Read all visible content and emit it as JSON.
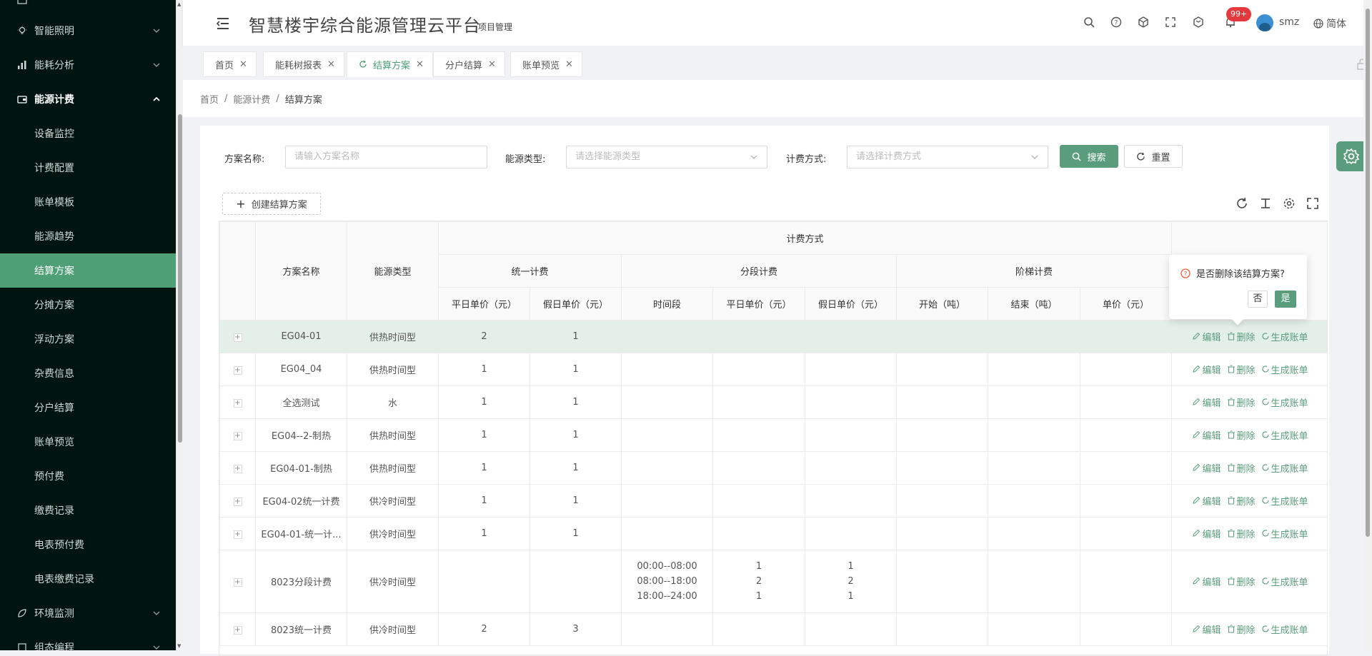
{
  "app": {
    "title": "智慧楼宇综合能源管理云平台",
    "subtitle": "项目管理",
    "notifications": "99+",
    "username": "smz",
    "language": "简体"
  },
  "sidebar": {
    "top_items": [
      {
        "label": "智能照明",
        "icon": "bulb-icon"
      },
      {
        "label": "能耗分析",
        "icon": "bar-chart-icon"
      },
      {
        "label": "能源计费",
        "icon": "wallet-icon"
      }
    ],
    "sub_items": [
      "设备监控",
      "计费配置",
      "账单模板",
      "能源趋势",
      "结算方案",
      "分摊方案",
      "浮动方案",
      "杂费信息",
      "分户结算",
      "账单预览",
      "预付费",
      "缴费记录",
      "电表预付费",
      "电表缴费记录"
    ],
    "bottom_items": [
      {
        "label": "环境监测",
        "icon": "leaf-icon"
      },
      {
        "label": "组态编程",
        "icon": "puzzle-icon"
      }
    ]
  },
  "tabs": [
    "首页",
    "能耗树报表",
    "结算方案",
    "分户结算",
    "账单预览"
  ],
  "breadcrumb": [
    "首页",
    "能源计费",
    "结算方案"
  ],
  "search": {
    "name_label": "方案名称:",
    "name_placeholder": "请输入方案名称",
    "type_label": "能源类型:",
    "type_placeholder": "请选择能源类型",
    "method_label": "计费方式:",
    "method_placeholder": "请选择计费方式",
    "search_button": "搜索",
    "reset_button": "重置"
  },
  "create_button": "创建结算方案",
  "table": {
    "headers": {
      "name": "方案名称",
      "type": "能源类型",
      "billing": "计费方式",
      "unified": "统一计费",
      "segmented": "分段计费",
      "tiered": "阶梯计费",
      "weekday_price": "平日单价（元）",
      "holiday_price": "假日单价（元）",
      "period": "时间段",
      "seg_weekday": "平日单价（元）",
      "seg_holiday": "假日单价（元）",
      "start": "开始（吨）",
      "end": "结束（吨）",
      "unit_price": "单价（元）"
    },
    "actions": {
      "edit": "编辑",
      "delete": "删除",
      "generate": "生成账单"
    },
    "rows": [
      {
        "name": "EG04-01",
        "type": "供热时间型",
        "weekday": "2",
        "holiday": "1",
        "periods": "",
        "seg_weekday": "",
        "seg_holiday": ""
      },
      {
        "name": "EG04_04",
        "type": "供热时间型",
        "weekday": "1",
        "holiday": "1",
        "periods": "",
        "seg_weekday": "",
        "seg_holiday": ""
      },
      {
        "name": "全选测试",
        "type": "水",
        "weekday": "1",
        "holiday": "1",
        "periods": "",
        "seg_weekday": "",
        "seg_holiday": ""
      },
      {
        "name": "EG04--2-制热",
        "type": "供热时间型",
        "weekday": "1",
        "holiday": "1",
        "periods": "",
        "seg_weekday": "",
        "seg_holiday": ""
      },
      {
        "name": "EG04-01-制热",
        "type": "供热时间型",
        "weekday": "1",
        "holiday": "1",
        "periods": "",
        "seg_weekday": "",
        "seg_holiday": ""
      },
      {
        "name": "EG04-02统一计费",
        "type": "供冷时间型",
        "weekday": "1",
        "holiday": "1",
        "periods": "",
        "seg_weekday": "",
        "seg_holiday": ""
      },
      {
        "name": "EG04-01-统一计...",
        "type": "供冷时间型",
        "weekday": "1",
        "holiday": "1",
        "periods": "",
        "seg_weekday": "",
        "seg_holiday": ""
      },
      {
        "name": "8023分段计费",
        "type": "供冷时间型",
        "weekday": "",
        "holiday": "",
        "periods": "",
        "seg_weekday": "",
        "seg_holiday": ""
      },
      {
        "name": "8023统一计费",
        "type": "供冷时间型",
        "weekday": "2",
        "holiday": "3",
        "periods": "",
        "seg_weekday": "",
        "seg_holiday": ""
      }
    ],
    "segmented_row": {
      "periods": [
        "00:00--08:00",
        "08:00--18:00",
        "18:00--24:00"
      ],
      "weekday": [
        "1",
        "2",
        "1"
      ],
      "holiday": [
        "1",
        "2",
        "1"
      ]
    }
  },
  "popconfirm": {
    "message": "是否删除该结算方案?",
    "cancel": "否",
    "confirm": "是"
  },
  "colors": {
    "accent": "#5a9d7c",
    "sidebar": "#001410",
    "active_nav": "#4e9e76",
    "badge": "#e4393c"
  }
}
